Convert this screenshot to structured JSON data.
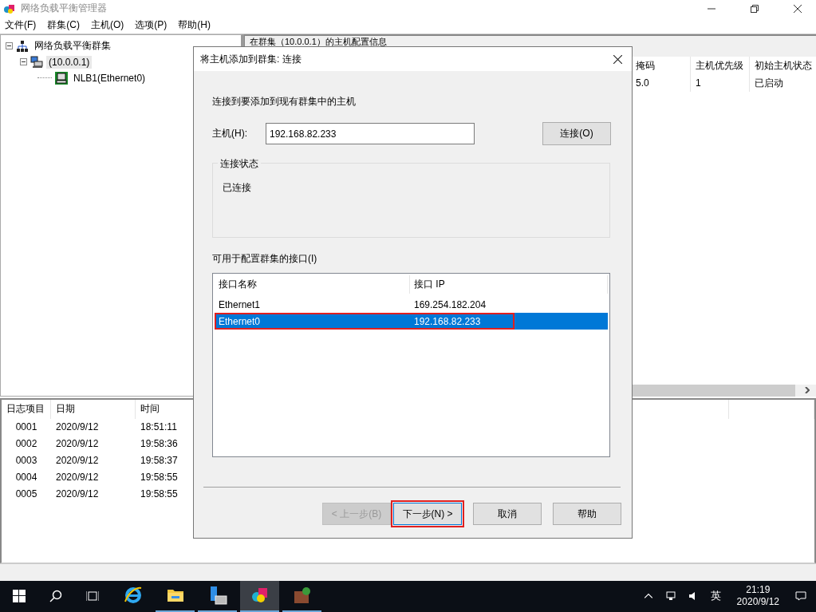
{
  "window": {
    "title": "网络负载平衡管理器"
  },
  "menu": [
    "文件(F)",
    "群集(C)",
    "主机(O)",
    "选项(P)",
    "帮助(H)"
  ],
  "tree": [
    {
      "label": "网络负载平衡群集",
      "kind": "root",
      "expanded": true,
      "selected": false,
      "children": [
        {
          "label": "(10.0.0.1)",
          "kind": "cluster",
          "expanded": true,
          "selected": true,
          "children": [
            {
              "label": "NLB1(Ethernet0)",
              "kind": "host",
              "selected": false
            }
          ]
        }
      ]
    }
  ],
  "host_panel": {
    "title": "在群集（10.0.0.1）的主机配置信息",
    "columns": [
      "掩码",
      "主机优先级",
      "初始主机状态"
    ],
    "rows": [
      [
        "5.0",
        "1",
        "已启动"
      ]
    ]
  },
  "log": {
    "columns": [
      "日志项目",
      "日期",
      "时间"
    ],
    "rows": [
      [
        "0001",
        "2020/9/12",
        "18:51:11"
      ],
      [
        "0002",
        "2020/9/12",
        "19:58:36"
      ],
      [
        "0003",
        "2020/9/12",
        "19:58:37"
      ],
      [
        "0004",
        "2020/9/12",
        "19:58:55"
      ],
      [
        "0005",
        "2020/9/12",
        "19:58:55"
      ]
    ]
  },
  "dialog": {
    "title": "将主机添加到群集: 连接",
    "intro": "连接到要添加到现有群集中的主机",
    "host_label": "主机(H):",
    "host_value": "192.168.82.233",
    "connect_button": "连接(O)",
    "status_group": "连接状态",
    "status_text": "已连接",
    "interfaces_label": "可用于配置群集的接口(I)",
    "interface_columns": [
      "接口名称",
      "接口 IP"
    ],
    "interfaces": [
      {
        "name": "Ethernet1",
        "ip": "169.254.182.204",
        "selected": false,
        "highlighted": false
      },
      {
        "name": "Ethernet0",
        "ip": "192.168.82.233",
        "selected": true,
        "highlighted": true
      }
    ],
    "buttons": [
      {
        "label": "< 上一步(B)",
        "disabled": true,
        "highlighted": false
      },
      {
        "label": "下一步(N) >",
        "disabled": false,
        "highlighted": true
      },
      {
        "label": "取消",
        "disabled": false,
        "highlighted": false
      },
      {
        "label": "帮助",
        "disabled": false,
        "highlighted": false
      }
    ]
  },
  "taskbar": {
    "apps": [
      {
        "kind": "ie",
        "active": false
      },
      {
        "kind": "folder",
        "active": false
      },
      {
        "kind": "server",
        "active": false
      },
      {
        "kind": "nlb",
        "active": true
      },
      {
        "kind": "box",
        "active": false
      }
    ],
    "input_method": "英",
    "time": "21:19",
    "date": "2020/9/12"
  }
}
